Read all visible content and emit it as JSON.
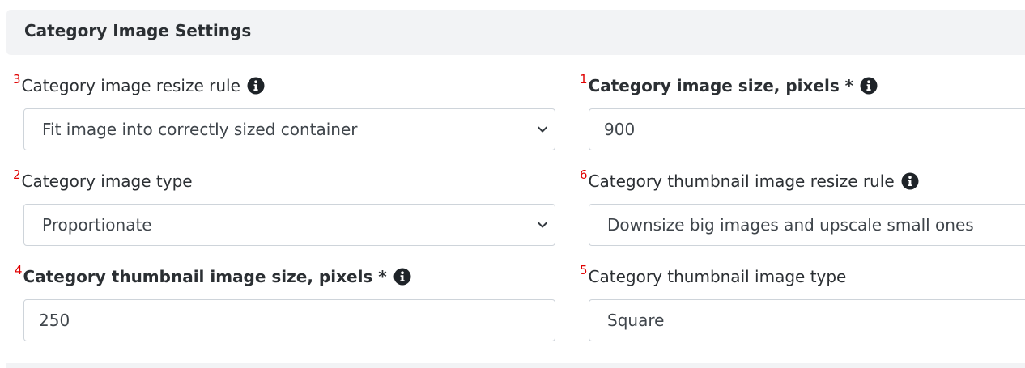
{
  "section": {
    "title": "Category Image Settings"
  },
  "fields": {
    "image_resize_rule": {
      "order": "3",
      "label": "Category image resize rule",
      "value": "Fit image into correctly sized container"
    },
    "image_size": {
      "order": "1",
      "label": "Category image size, pixels *",
      "value": "900"
    },
    "image_type": {
      "order": "2",
      "label": "Category image type",
      "value": "Proportionate"
    },
    "thumbnail_resize_rule": {
      "order": "6",
      "label": "Category thumbnail image resize rule",
      "value": "Downsize big images and upscale small ones"
    },
    "thumbnail_size": {
      "order": "4",
      "label": "Category thumbnail image size, pixels *",
      "value": "250"
    },
    "thumbnail_type": {
      "order": "5",
      "label": "Category thumbnail image type",
      "value": "Square"
    }
  },
  "icons": {
    "info": "info-circle-icon",
    "dropdown": "chevron-down-icon"
  },
  "colors": {
    "order_number": "#e00000",
    "header_background": "#f2f3f5",
    "border": "#ced4da",
    "text": "#2b2f33"
  }
}
